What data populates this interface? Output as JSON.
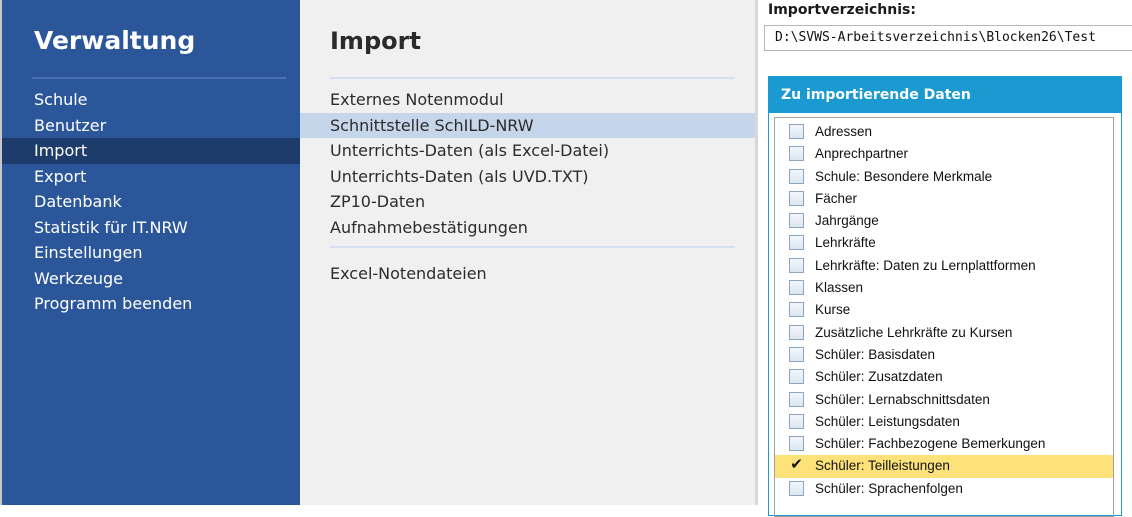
{
  "sidebar": {
    "title": "Verwaltung",
    "items": [
      {
        "label": "Schule",
        "active": false
      },
      {
        "label": "Benutzer",
        "active": false
      },
      {
        "label": "Import",
        "active": true
      },
      {
        "label": "Export",
        "active": false
      },
      {
        "label": "Datenbank",
        "active": false
      },
      {
        "label": "Statistik für IT.NRW",
        "active": false
      },
      {
        "label": "Einstellungen",
        "active": false
      },
      {
        "label": "Werkzeuge",
        "active": false
      },
      {
        "label": "Programm beenden",
        "active": false
      }
    ]
  },
  "middle": {
    "title": "Import",
    "group1": [
      {
        "label": "Externes Notenmodul",
        "active": false
      },
      {
        "label": "Schnittstelle SchILD-NRW",
        "active": true
      },
      {
        "label": "Unterrichts-Daten (als Excel-Datei)",
        "active": false
      },
      {
        "label": "Unterrichts-Daten (als UVD.TXT)",
        "active": false
      },
      {
        "label": "ZP10-Daten",
        "active": false
      },
      {
        "label": "Aufnahmebestätigungen",
        "active": false
      }
    ],
    "group2": [
      {
        "label": "Excel-Notendateien",
        "active": false
      }
    ]
  },
  "right": {
    "directory_label": "Importverzeichnis:",
    "directory_value": "D:\\SVWS-Arbeitsverzeichnis\\Blocken26\\Test",
    "group_title": "Zu importierende Daten",
    "items": [
      {
        "label": "Adressen",
        "checked": false
      },
      {
        "label": "Anprechpartner",
        "checked": false
      },
      {
        "label": "Schule: Besondere Merkmale",
        "checked": false
      },
      {
        "label": "Fächer",
        "checked": false
      },
      {
        "label": "Jahrgänge",
        "checked": false
      },
      {
        "label": "Lehrkräfte",
        "checked": false
      },
      {
        "label": "Lehrkräfte: Daten zu Lernplattformen",
        "checked": false
      },
      {
        "label": "Klassen",
        "checked": false
      },
      {
        "label": "Kurse",
        "checked": false
      },
      {
        "label": "Zusätzliche Lehrkräfte zu Kursen",
        "checked": false
      },
      {
        "label": "Schüler: Basisdaten",
        "checked": false
      },
      {
        "label": "Schüler: Zusatzdaten",
        "checked": false
      },
      {
        "label": "Schüler: Lernabschnittsdaten",
        "checked": false
      },
      {
        "label": "Schüler: Leistungsdaten",
        "checked": false
      },
      {
        "label": "Schüler: Fachbezogene Bemerkungen",
        "checked": false
      },
      {
        "label": "Schüler: Teilleistungen",
        "checked": true
      },
      {
        "label": "Schüler: Sprachenfolgen",
        "checked": false
      }
    ],
    "check_glyph": "✔"
  },
  "colors": {
    "sidebar_bg": "#2b579a",
    "sidebar_active": "#1d3c6b",
    "middle_bg": "#f0f0f0",
    "middle_active": "#c5d5ea",
    "group_header": "#1a9ad0",
    "selected_row": "#fde27a"
  }
}
